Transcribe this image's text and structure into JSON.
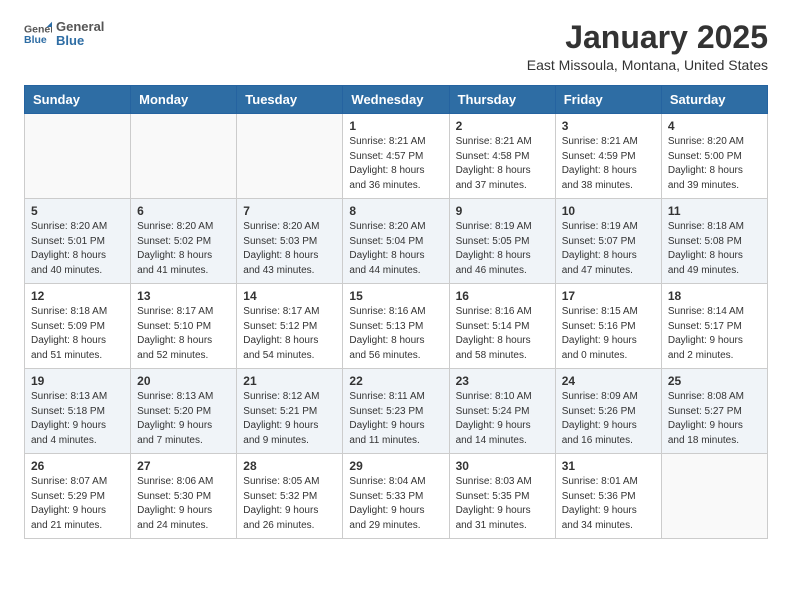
{
  "header": {
    "logo_general": "General",
    "logo_blue": "Blue",
    "month": "January 2025",
    "location": "East Missoula, Montana, United States"
  },
  "days_of_week": [
    "Sunday",
    "Monday",
    "Tuesday",
    "Wednesday",
    "Thursday",
    "Friday",
    "Saturday"
  ],
  "weeks": [
    {
      "row_class": "normal",
      "days": [
        {
          "number": "",
          "info": "",
          "empty": true
        },
        {
          "number": "",
          "info": "",
          "empty": true
        },
        {
          "number": "",
          "info": "",
          "empty": true
        },
        {
          "number": "1",
          "info": "Sunrise: 8:21 AM\nSunset: 4:57 PM\nDaylight: 8 hours\nand 36 minutes.",
          "empty": false
        },
        {
          "number": "2",
          "info": "Sunrise: 8:21 AM\nSunset: 4:58 PM\nDaylight: 8 hours\nand 37 minutes.",
          "empty": false
        },
        {
          "number": "3",
          "info": "Sunrise: 8:21 AM\nSunset: 4:59 PM\nDaylight: 8 hours\nand 38 minutes.",
          "empty": false
        },
        {
          "number": "4",
          "info": "Sunrise: 8:20 AM\nSunset: 5:00 PM\nDaylight: 8 hours\nand 39 minutes.",
          "empty": false
        }
      ]
    },
    {
      "row_class": "alt",
      "days": [
        {
          "number": "5",
          "info": "Sunrise: 8:20 AM\nSunset: 5:01 PM\nDaylight: 8 hours\nand 40 minutes.",
          "empty": false
        },
        {
          "number": "6",
          "info": "Sunrise: 8:20 AM\nSunset: 5:02 PM\nDaylight: 8 hours\nand 41 minutes.",
          "empty": false
        },
        {
          "number": "7",
          "info": "Sunrise: 8:20 AM\nSunset: 5:03 PM\nDaylight: 8 hours\nand 43 minutes.",
          "empty": false
        },
        {
          "number": "8",
          "info": "Sunrise: 8:20 AM\nSunset: 5:04 PM\nDaylight: 8 hours\nand 44 minutes.",
          "empty": false
        },
        {
          "number": "9",
          "info": "Sunrise: 8:19 AM\nSunset: 5:05 PM\nDaylight: 8 hours\nand 46 minutes.",
          "empty": false
        },
        {
          "number": "10",
          "info": "Sunrise: 8:19 AM\nSunset: 5:07 PM\nDaylight: 8 hours\nand 47 minutes.",
          "empty": false
        },
        {
          "number": "11",
          "info": "Sunrise: 8:18 AM\nSunset: 5:08 PM\nDaylight: 8 hours\nand 49 minutes.",
          "empty": false
        }
      ]
    },
    {
      "row_class": "normal",
      "days": [
        {
          "number": "12",
          "info": "Sunrise: 8:18 AM\nSunset: 5:09 PM\nDaylight: 8 hours\nand 51 minutes.",
          "empty": false
        },
        {
          "number": "13",
          "info": "Sunrise: 8:17 AM\nSunset: 5:10 PM\nDaylight: 8 hours\nand 52 minutes.",
          "empty": false
        },
        {
          "number": "14",
          "info": "Sunrise: 8:17 AM\nSunset: 5:12 PM\nDaylight: 8 hours\nand 54 minutes.",
          "empty": false
        },
        {
          "number": "15",
          "info": "Sunrise: 8:16 AM\nSunset: 5:13 PM\nDaylight: 8 hours\nand 56 minutes.",
          "empty": false
        },
        {
          "number": "16",
          "info": "Sunrise: 8:16 AM\nSunset: 5:14 PM\nDaylight: 8 hours\nand 58 minutes.",
          "empty": false
        },
        {
          "number": "17",
          "info": "Sunrise: 8:15 AM\nSunset: 5:16 PM\nDaylight: 9 hours\nand 0 minutes.",
          "empty": false
        },
        {
          "number": "18",
          "info": "Sunrise: 8:14 AM\nSunset: 5:17 PM\nDaylight: 9 hours\nand 2 minutes.",
          "empty": false
        }
      ]
    },
    {
      "row_class": "alt",
      "days": [
        {
          "number": "19",
          "info": "Sunrise: 8:13 AM\nSunset: 5:18 PM\nDaylight: 9 hours\nand 4 minutes.",
          "empty": false
        },
        {
          "number": "20",
          "info": "Sunrise: 8:13 AM\nSunset: 5:20 PM\nDaylight: 9 hours\nand 7 minutes.",
          "empty": false
        },
        {
          "number": "21",
          "info": "Sunrise: 8:12 AM\nSunset: 5:21 PM\nDaylight: 9 hours\nand 9 minutes.",
          "empty": false
        },
        {
          "number": "22",
          "info": "Sunrise: 8:11 AM\nSunset: 5:23 PM\nDaylight: 9 hours\nand 11 minutes.",
          "empty": false
        },
        {
          "number": "23",
          "info": "Sunrise: 8:10 AM\nSunset: 5:24 PM\nDaylight: 9 hours\nand 14 minutes.",
          "empty": false
        },
        {
          "number": "24",
          "info": "Sunrise: 8:09 AM\nSunset: 5:26 PM\nDaylight: 9 hours\nand 16 minutes.",
          "empty": false
        },
        {
          "number": "25",
          "info": "Sunrise: 8:08 AM\nSunset: 5:27 PM\nDaylight: 9 hours\nand 18 minutes.",
          "empty": false
        }
      ]
    },
    {
      "row_class": "normal",
      "days": [
        {
          "number": "26",
          "info": "Sunrise: 8:07 AM\nSunset: 5:29 PM\nDaylight: 9 hours\nand 21 minutes.",
          "empty": false
        },
        {
          "number": "27",
          "info": "Sunrise: 8:06 AM\nSunset: 5:30 PM\nDaylight: 9 hours\nand 24 minutes.",
          "empty": false
        },
        {
          "number": "28",
          "info": "Sunrise: 8:05 AM\nSunset: 5:32 PM\nDaylight: 9 hours\nand 26 minutes.",
          "empty": false
        },
        {
          "number": "29",
          "info": "Sunrise: 8:04 AM\nSunset: 5:33 PM\nDaylight: 9 hours\nand 29 minutes.",
          "empty": false
        },
        {
          "number": "30",
          "info": "Sunrise: 8:03 AM\nSunset: 5:35 PM\nDaylight: 9 hours\nand 31 minutes.",
          "empty": false
        },
        {
          "number": "31",
          "info": "Sunrise: 8:01 AM\nSunset: 5:36 PM\nDaylight: 9 hours\nand 34 minutes.",
          "empty": false
        },
        {
          "number": "",
          "info": "",
          "empty": true
        }
      ]
    }
  ]
}
